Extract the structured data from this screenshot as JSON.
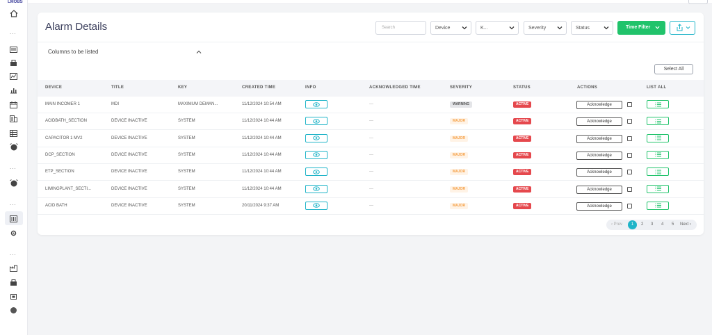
{
  "app": {
    "logo_text": "LMOBS"
  },
  "sidebar": {
    "dots": "...",
    "icons": [
      "home-icon",
      "report-icon",
      "dashboard-icon",
      "analytics-icon",
      "bar-chart-icon",
      "calendar-icon",
      "building-icon",
      "table-icon",
      "alarm-icon",
      "alarm-icon",
      "server-icon",
      "settings-gear-icon",
      "factory-icon",
      "grid-icon",
      "chip-icon",
      "circle-icon"
    ]
  },
  "page": {
    "title": "Alarm Details"
  },
  "filters": {
    "search_placeholder": "Search",
    "device": "Device",
    "key": "K...",
    "severity": "Severity",
    "status": "Status",
    "time_filter": "Time Filter"
  },
  "columns_section": {
    "label": "Columns to be listed"
  },
  "select_all_label": "Select All",
  "table": {
    "headers": [
      "DEVICE",
      "TITLE",
      "KEY",
      "CREATED TIME",
      "INFO",
      "ACKNOWLEDGED TIME",
      "SEVERITY",
      "STATUS",
      "ACTIONS",
      "LIST ALL"
    ],
    "rows": [
      {
        "device": "MAIN INCOMER 1",
        "title": "MDI",
        "key": "MAXIMUM DEMAN...",
        "created": "11/12/2024 10:54 AM",
        "ack_time": "---",
        "severity": "WARNING",
        "status": "ACTIVE",
        "action": "Acknowledge"
      },
      {
        "device": "ACIDBATH_SECTION",
        "title": "DEVICE INACTIVE",
        "key": "SYSTEM",
        "created": "11/12/2024 10:44 AM",
        "ack_time": "---",
        "severity": "MAJOR",
        "status": "ACTIVE",
        "action": "Acknowledge"
      },
      {
        "device": "CAPACITOR 1 MV2",
        "title": "DEVICE INACTIVE",
        "key": "SYSTEM",
        "created": "11/12/2024 10:44 AM",
        "ack_time": "---",
        "severity": "MAJOR",
        "status": "ACTIVE",
        "action": "Acknowledge"
      },
      {
        "device": "DCP_SECTION",
        "title": "DEVICE INACTIVE",
        "key": "SYSTEM",
        "created": "11/12/2024 10:44 AM",
        "ack_time": "---",
        "severity": "MAJOR",
        "status": "ACTIVE",
        "action": "Acknowledge"
      },
      {
        "device": "ETP_SECTION",
        "title": "DEVICE INACTIVE",
        "key": "SYSTEM",
        "created": "11/12/2024 10:44 AM",
        "ack_time": "---",
        "severity": "MAJOR",
        "status": "ACTIVE",
        "action": "Acknowledge"
      },
      {
        "device": "LIMINGPLANT_SECTI...",
        "title": "DEVICE INACTIVE",
        "key": "SYSTEM",
        "created": "11/12/2024 10:44 AM",
        "ack_time": "---",
        "severity": "MAJOR",
        "status": "ACTIVE",
        "action": "Acknowledge"
      },
      {
        "device": "ACID BATH",
        "title": "DEVICE INACTIVE",
        "key": "SYSTEM",
        "created": "20/11/2024 9:37 AM",
        "ack_time": "---",
        "severity": "MAJOR",
        "status": "ACTIVE",
        "action": "Acknowledge"
      }
    ]
  },
  "pagination": {
    "prev": "‹ Prev",
    "pages": [
      "1",
      "2",
      "3",
      "4",
      "5"
    ],
    "current": "1",
    "next": "Next ›"
  },
  "colors": {
    "accent": "#1fb4c8",
    "success": "#21c36b",
    "danger": "#e5484d",
    "major": "#f59e42",
    "warning_bg": "#e4e5e8"
  }
}
